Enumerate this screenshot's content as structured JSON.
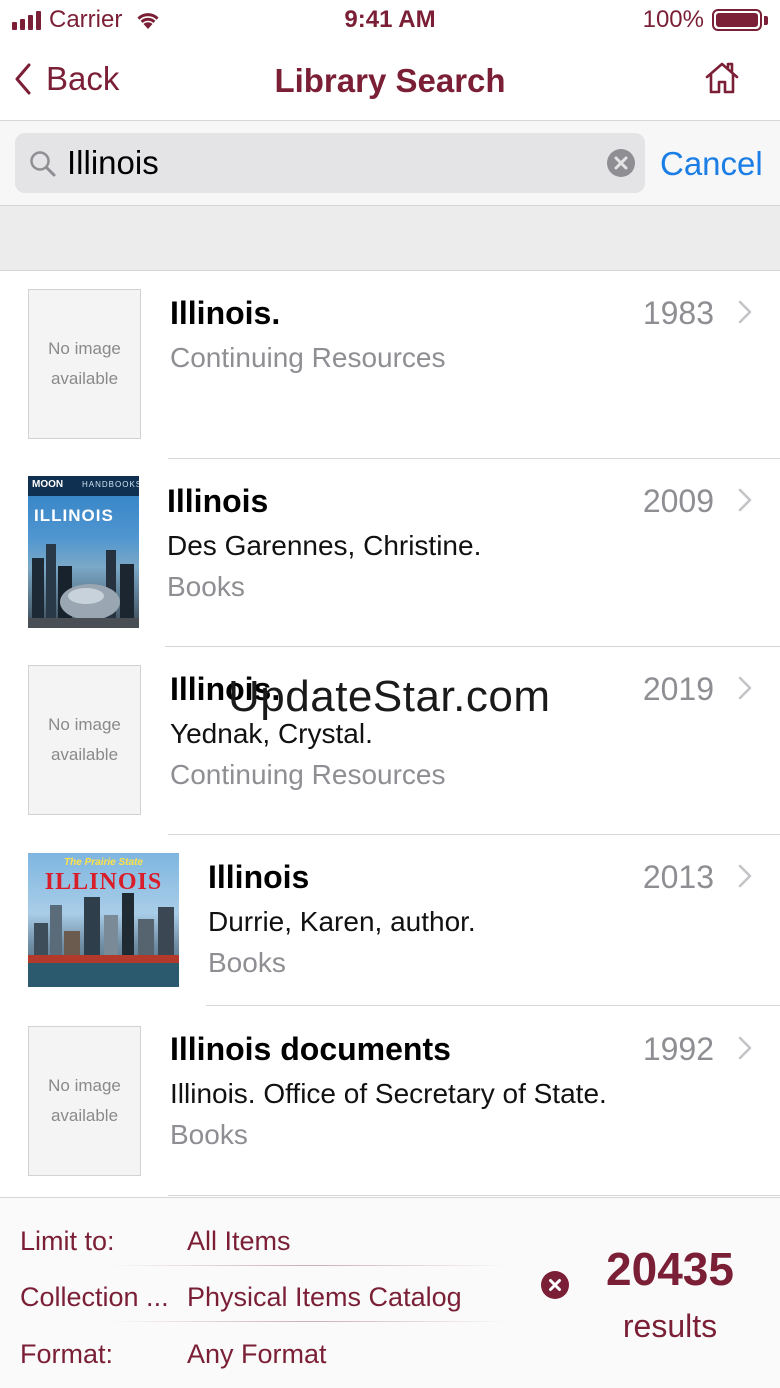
{
  "status_bar": {
    "carrier": "Carrier",
    "time": "9:41 AM",
    "battery": "100%",
    "battery_level": 1.0
  },
  "nav": {
    "back_label": "Back",
    "title": "Library Search",
    "home_icon": "house-icon"
  },
  "search": {
    "value": "Illinois",
    "cancel_label": "Cancel",
    "search_icon": "magnifier-icon",
    "clear_icon": "x-circle-icon"
  },
  "results": [
    {
      "title": "Illinois.",
      "author": "",
      "type": "Continuing Resources",
      "year": "1983",
      "thumb": "none",
      "no_image_line1": "No image",
      "no_image_line2": "available"
    },
    {
      "title": "Illinois",
      "author": "Des Garennes, Christine.",
      "type": "Books",
      "year": "2009",
      "thumb": "cover",
      "cover_brand": "MOON",
      "cover_series": "HANDBOOKS",
      "cover_title": "ILLINOIS"
    },
    {
      "title": "Illinois.",
      "author": "Yednak, Crystal.",
      "type": "Continuing Resources",
      "year": "2019",
      "thumb": "none",
      "no_image_line1": "No image",
      "no_image_line2": "available"
    },
    {
      "title": "Illinois",
      "author": "Durrie, Karen, author.",
      "type": "Books",
      "year": "2013",
      "thumb": "cover",
      "cover_tagline": "The Prairie State",
      "cover_title": "ILLINOIS"
    },
    {
      "title": "Illinois documents",
      "author": "Illinois. Office of Secretary of State.",
      "type": "Books",
      "year": "1992",
      "thumb": "none",
      "no_image_line1": "No image",
      "no_image_line2": "available"
    }
  ],
  "watermark": "UpdateStar.com",
  "footer": {
    "limit_label": "Limit to:",
    "limit_value": "All Items",
    "collection_label": "Collection ...",
    "collection_value": "Physical Items Catalog",
    "format_label": "Format:",
    "format_value": "Any Format",
    "count": "20435",
    "count_label": "results"
  },
  "colors": {
    "brand": "#7a1f35",
    "link": "#1a7ee6",
    "secondary_text": "#8e8e93"
  }
}
